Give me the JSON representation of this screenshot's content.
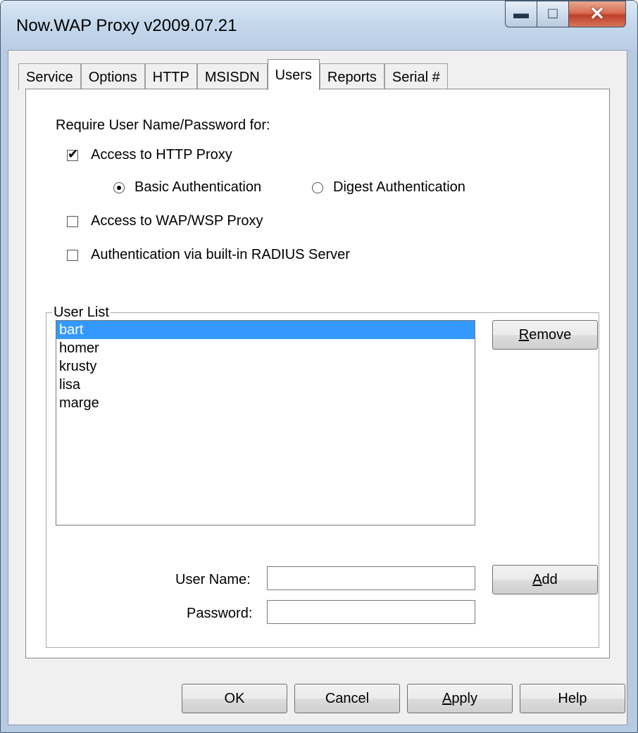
{
  "window": {
    "title": "Now.WAP Proxy v2009.07.21",
    "controls": {
      "minimize": "minimize-icon",
      "maximize": "maximize-icon",
      "close": "close-icon"
    }
  },
  "tabs": [
    {
      "label": "Service",
      "active": false
    },
    {
      "label": "Options",
      "active": false
    },
    {
      "label": "HTTP",
      "active": false
    },
    {
      "label": "MSISDN",
      "active": false
    },
    {
      "label": "Users",
      "active": true
    },
    {
      "label": "Reports",
      "active": false
    },
    {
      "label": "Serial #",
      "active": false
    }
  ],
  "users_page": {
    "require_label": "Require User Name/Password for:",
    "http_proxy": {
      "label": "Access to HTTP Proxy",
      "checked": true
    },
    "auth_basic": {
      "label": "Basic Authentication",
      "selected": true
    },
    "auth_digest": {
      "label": "Digest Authentication",
      "selected": false
    },
    "wap_proxy": {
      "label": "Access to WAP/WSP Proxy",
      "checked": false
    },
    "radius": {
      "label": "Authentication via built-in RADIUS Server",
      "checked": false
    },
    "user_list": {
      "legend": "User List",
      "items": [
        "bart",
        "homer",
        "krusty",
        "lisa",
        "marge"
      ],
      "selected_index": 0
    },
    "remove_button": {
      "hotkey": "R",
      "rest": "emove"
    },
    "user_name_label": "User Name:",
    "user_name_value": "",
    "password_label": "Password:",
    "password_value": "",
    "add_button": {
      "hotkey": "A",
      "rest": "dd"
    }
  },
  "footer": {
    "ok": "OK",
    "cancel": "Cancel",
    "apply": {
      "hotkey": "A",
      "rest": "pply"
    },
    "help": "Help"
  },
  "colors": {
    "selection": "#3399ff",
    "page_bg": "#ffffff",
    "dialog_bg": "#f0f0f0",
    "close_button": "#c8452d"
  }
}
